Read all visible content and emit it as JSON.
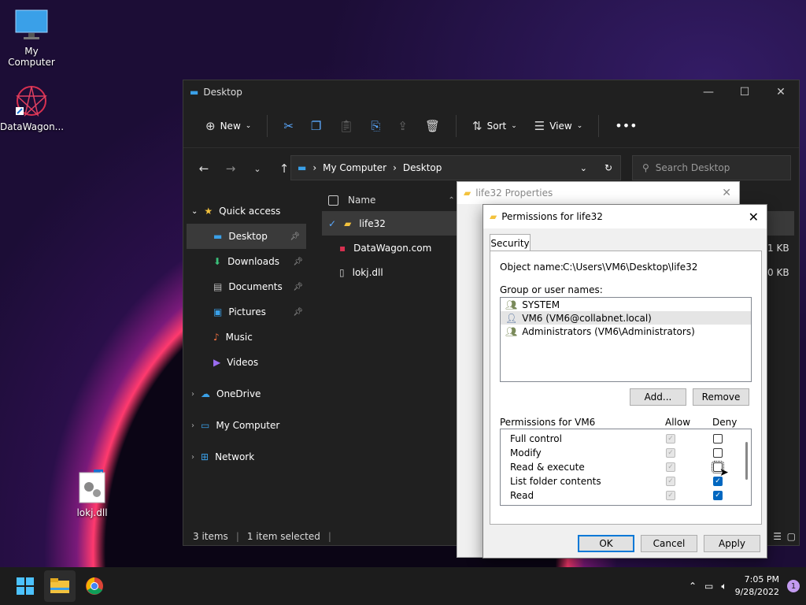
{
  "desktop": {
    "icons": [
      {
        "label": "My Computer"
      },
      {
        "label": "DataWagon..."
      },
      {
        "label": "lokj.dll"
      }
    ]
  },
  "explorer": {
    "title": "Desktop",
    "toolbar": {
      "new": "New",
      "sort": "Sort",
      "view": "View"
    },
    "breadcrumb": [
      "My Computer",
      "Desktop"
    ],
    "search_placeholder": "Search Desktop",
    "sidebar": {
      "quick_access": "Quick access",
      "items": [
        "Desktop",
        "Downloads",
        "Documents",
        "Pictures",
        "Music",
        "Videos"
      ],
      "onedrive": "OneDrive",
      "my_computer": "My Computer",
      "network": "Network"
    },
    "columns": {
      "name": "Name"
    },
    "files": [
      {
        "name": "life32",
        "size": ""
      },
      {
        "name": "DataWagon.com",
        "size": "1 KB"
      },
      {
        "name": "lokj.dll",
        "size": "0 KB"
      }
    ],
    "status": {
      "items": "3 items",
      "selected": "1 item selected"
    }
  },
  "properties": {
    "title": "life32 Properties"
  },
  "permissions": {
    "title": "Permissions for life32",
    "tab": "Security",
    "object_label": "Object name:",
    "object_value": "C:\\Users\\VM6\\Desktop\\life32",
    "groups_label": "Group or user names:",
    "groups": [
      "SYSTEM",
      "VM6 (VM6@collabnet.local)",
      "Administrators (VM6\\Administrators)"
    ],
    "add": "Add...",
    "remove": "Remove",
    "perm_label": "Permissions for VM6",
    "allow": "Allow",
    "deny": "Deny",
    "perms": [
      {
        "name": "Full control",
        "allow": true,
        "deny": false
      },
      {
        "name": "Modify",
        "allow": true,
        "deny": false
      },
      {
        "name": "Read & execute",
        "allow": true,
        "deny": false
      },
      {
        "name": "List folder contents",
        "allow": true,
        "deny": true
      },
      {
        "name": "Read",
        "allow": true,
        "deny": true
      }
    ],
    "ok": "OK",
    "cancel": "Cancel",
    "apply": "Apply"
  },
  "taskbar": {
    "time": "7:05 PM",
    "date": "9/28/2022",
    "badge": "1"
  }
}
